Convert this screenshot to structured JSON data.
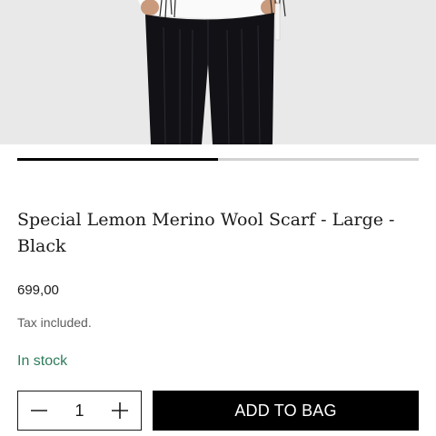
{
  "product": {
    "title": "Special Lemon Merino Wool Scarf - Large - Black",
    "price": "699,00",
    "tax_note": "Tax included.",
    "stock_status": "In stock",
    "stock_color": "#2e7d5b"
  },
  "gallery": {
    "progress_fraction": 0.5
  },
  "quantity": {
    "value": "1",
    "decrement_icon": "minus-icon",
    "increment_icon": "plus-icon"
  },
  "actions": {
    "add_to_bag_label": "ADD TO BAG",
    "add_to_bag_color": "#000000"
  }
}
